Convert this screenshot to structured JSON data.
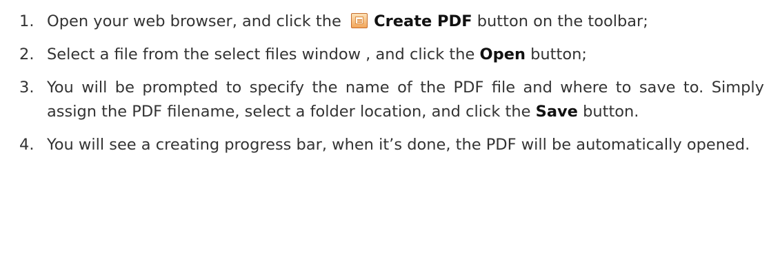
{
  "steps": [
    {
      "number": "1.",
      "text_before": "Open your web browser, and click the",
      "icon": "create-pdf-icon",
      "bold": "Create PDF",
      "text_after": " button on the toolbar;"
    },
    {
      "number": "2.",
      "text_before": "Select a file from the select files window , and click the ",
      "bold": "Open",
      "text_after": " button;"
    },
    {
      "number": "3.",
      "text_before": "You will be prompted to specify the name of the PDF file and where to save to. Simply assign the PDF filename, select a folder location, and click the ",
      "bold": "Save",
      "text_after": " button."
    },
    {
      "number": "4.",
      "text": "You will see a creating progress bar, when it’s done, the PDF will be automatically opened."
    }
  ]
}
